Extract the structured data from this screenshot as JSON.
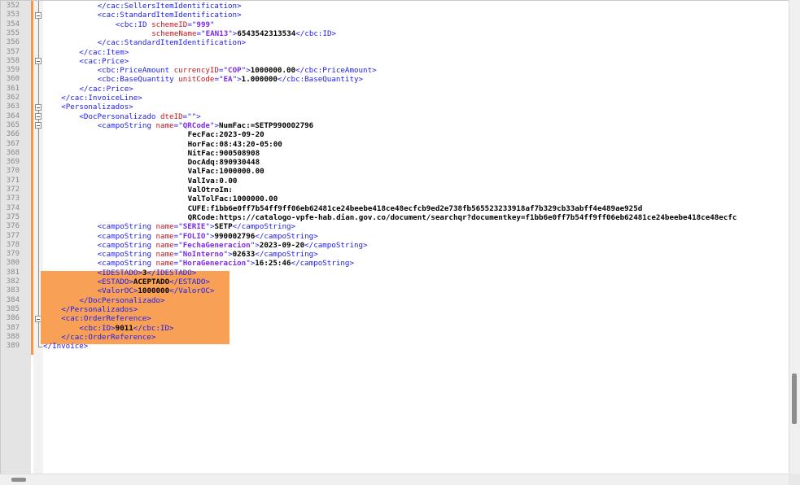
{
  "editor": {
    "lines": [
      {
        "n": "352",
        "indent": 12,
        "parts": [
          [
            "t",
            "</cac:SellersItemIdentification>"
          ]
        ]
      },
      {
        "n": "353",
        "indent": 12,
        "parts": [
          [
            "t",
            "<cac:StandardItemIdentification>"
          ]
        ]
      },
      {
        "n": "354",
        "indent": 16,
        "parts": [
          [
            "t",
            "<cbc:ID "
          ],
          [
            "a",
            "schemeID"
          ],
          [
            "t",
            "=\""
          ],
          [
            "v",
            "999"
          ],
          [
            "t",
            "\""
          ]
        ]
      },
      {
        "n": "355",
        "indent": 24,
        "parts": [
          [
            "a",
            "schemeName"
          ],
          [
            "t",
            "=\""
          ],
          [
            "v",
            "EAN13"
          ],
          [
            "t",
            "\">"
          ],
          [
            "x",
            "6543542313534"
          ],
          [
            "t",
            "</cbc:ID>"
          ]
        ]
      },
      {
        "n": "356",
        "indent": 12,
        "parts": [
          [
            "t",
            "</cac:StandardItemIdentification>"
          ]
        ]
      },
      {
        "n": "357",
        "indent": 8,
        "parts": [
          [
            "t",
            "</cac:Item>"
          ]
        ]
      },
      {
        "n": "358",
        "indent": 8,
        "parts": [
          [
            "t",
            "<cac:Price>"
          ]
        ]
      },
      {
        "n": "359",
        "indent": 12,
        "parts": [
          [
            "t",
            "<cbc:PriceAmount "
          ],
          [
            "a",
            "currencyID"
          ],
          [
            "t",
            "=\""
          ],
          [
            "v",
            "COP"
          ],
          [
            "t",
            "\">"
          ],
          [
            "x",
            "1000000.00"
          ],
          [
            "t",
            "</cbc:PriceAmount>"
          ]
        ]
      },
      {
        "n": "360",
        "indent": 12,
        "parts": [
          [
            "t",
            "<cbc:BaseQuantity "
          ],
          [
            "a",
            "unitCode"
          ],
          [
            "t",
            "=\""
          ],
          [
            "v",
            "EA"
          ],
          [
            "t",
            "\">"
          ],
          [
            "x",
            "1.000000"
          ],
          [
            "t",
            "</cbc:BaseQuantity>"
          ]
        ]
      },
      {
        "n": "361",
        "indent": 8,
        "parts": [
          [
            "t",
            "</cac:Price>"
          ]
        ]
      },
      {
        "n": "362",
        "indent": 4,
        "parts": [
          [
            "t",
            "</cac:InvoiceLine>"
          ]
        ]
      },
      {
        "n": "363",
        "indent": 4,
        "parts": [
          [
            "t",
            "<Personalizados>"
          ]
        ]
      },
      {
        "n": "364",
        "indent": 8,
        "parts": [
          [
            "t",
            "<DocPersonalizado "
          ],
          [
            "a",
            "dteID"
          ],
          [
            "t",
            "=\"\">"
          ]
        ]
      },
      {
        "n": "365",
        "indent": 12,
        "parts": [
          [
            "t",
            "<campoString "
          ],
          [
            "a",
            "name"
          ],
          [
            "t",
            "=\""
          ],
          [
            "v",
            "QRCode"
          ],
          [
            "t",
            "\">"
          ],
          [
            "x",
            "NumFac:=SETP990002796"
          ]
        ]
      },
      {
        "n": "366",
        "indent": 32,
        "parts": [
          [
            "x",
            "FecFac:2023-09-20"
          ]
        ]
      },
      {
        "n": "367",
        "indent": 32,
        "parts": [
          [
            "x",
            "HorFac:08:43:20-05:00"
          ]
        ]
      },
      {
        "n": "368",
        "indent": 32,
        "parts": [
          [
            "x",
            "NitFac:900508908"
          ]
        ]
      },
      {
        "n": "369",
        "indent": 32,
        "parts": [
          [
            "x",
            "DocAdq:890930448"
          ]
        ]
      },
      {
        "n": "370",
        "indent": 32,
        "parts": [
          [
            "x",
            "ValFac:1000000.00"
          ]
        ]
      },
      {
        "n": "371",
        "indent": 32,
        "parts": [
          [
            "x",
            "ValIva:0.00"
          ]
        ]
      },
      {
        "n": "372",
        "indent": 32,
        "parts": [
          [
            "x",
            "ValOtroIm:"
          ]
        ]
      },
      {
        "n": "373",
        "indent": 32,
        "parts": [
          [
            "x",
            "ValTolFac:1000000.00"
          ]
        ]
      },
      {
        "n": "374",
        "indent": 32,
        "parts": [
          [
            "x",
            "CUFE:f1bb6e0ff7b54ff9ff06eb62481ce24beebe418ce48ecfcb9ed2e738fb565523233918af7b329cb33abff4e489ae925d"
          ]
        ]
      },
      {
        "n": "375",
        "indent": 32,
        "parts": [
          [
            "x",
            "QRCode:https://catalogo-vpfe-hab.dian.gov.co/document/searchqr?documentkey=f1bb6e0ff7b54ff9ff06eb62481ce24beebe418ce48ecfc"
          ]
        ]
      },
      {
        "n": "376",
        "indent": 12,
        "parts": [
          [
            "t",
            "<campoString "
          ],
          [
            "a",
            "name"
          ],
          [
            "t",
            "=\""
          ],
          [
            "v",
            "SERIE"
          ],
          [
            "t",
            "\">"
          ],
          [
            "x",
            "SETP"
          ],
          [
            "t",
            "</campoString>"
          ]
        ]
      },
      {
        "n": "377",
        "indent": 12,
        "parts": [
          [
            "t",
            "<campoString "
          ],
          [
            "a",
            "name"
          ],
          [
            "t",
            "=\""
          ],
          [
            "v",
            "FOLIO"
          ],
          [
            "t",
            "\">"
          ],
          [
            "x",
            "990002796"
          ],
          [
            "t",
            "</campoString>"
          ]
        ]
      },
      {
        "n": "378",
        "indent": 12,
        "parts": [
          [
            "t",
            "<campoString "
          ],
          [
            "a",
            "name"
          ],
          [
            "t",
            "=\""
          ],
          [
            "v",
            "FechaGeneracion"
          ],
          [
            "t",
            "\">"
          ],
          [
            "x",
            "2023-09-20"
          ],
          [
            "t",
            "</campoString>"
          ]
        ]
      },
      {
        "n": "379",
        "indent": 12,
        "parts": [
          [
            "t",
            "<campoString "
          ],
          [
            "a",
            "name"
          ],
          [
            "t",
            "=\""
          ],
          [
            "v",
            "NoInterno"
          ],
          [
            "t",
            "\">"
          ],
          [
            "x",
            "02633"
          ],
          [
            "t",
            "</campoString>"
          ]
        ]
      },
      {
        "n": "380",
        "indent": 12,
        "parts": [
          [
            "t",
            "<campoString "
          ],
          [
            "a",
            "name"
          ],
          [
            "t",
            "=\""
          ],
          [
            "v",
            "HoraGeneracion"
          ],
          [
            "t",
            "\">"
          ],
          [
            "x",
            "16:25:46"
          ],
          [
            "t",
            "</campoString>"
          ]
        ]
      },
      {
        "n": "381",
        "indent": 12,
        "parts": [
          [
            "t",
            "<IDESTADO>"
          ],
          [
            "x",
            "3"
          ],
          [
            "t",
            "</IDESTADO>"
          ]
        ]
      },
      {
        "n": "382",
        "indent": 12,
        "parts": [
          [
            "t",
            "<ESTADO>"
          ],
          [
            "x",
            "ACEPTADO"
          ],
          [
            "t",
            "</ESTADO>"
          ]
        ]
      },
      {
        "n": "383",
        "indent": 12,
        "parts": [
          [
            "t",
            "<ValorOC>"
          ],
          [
            "x",
            "1000000"
          ],
          [
            "t",
            "</ValorOC>"
          ]
        ]
      },
      {
        "n": "384",
        "indent": 8,
        "parts": [
          [
            "t",
            "</DocPersonalizado>"
          ]
        ]
      },
      {
        "n": "385",
        "indent": 4,
        "parts": [
          [
            "t",
            "</Personalizados>"
          ]
        ]
      },
      {
        "n": "386",
        "indent": 4,
        "parts": [
          [
            "t",
            "<cac:OrderReference>"
          ]
        ]
      },
      {
        "n": "387",
        "indent": 8,
        "parts": [
          [
            "t",
            "<cbc:ID>"
          ],
          [
            "x",
            "9011"
          ],
          [
            "t",
            "</cbc:ID>"
          ]
        ]
      },
      {
        "n": "388",
        "indent": 4,
        "parts": [
          [
            "t",
            "</cac:OrderReference>"
          ]
        ]
      },
      {
        "n": "389",
        "indent": 0,
        "parts": [
          [
            "t",
            "</Invoice>"
          ]
        ]
      }
    ]
  },
  "colors": {
    "tag": "#1c1cf0",
    "attribute": "#c8161e",
    "attribute_value": "#7d2ae8",
    "text": "#000000",
    "selection": "#f9a057",
    "change_bar": "#f79646"
  },
  "icons": {
    "fold": "fold-collapse-icon"
  }
}
